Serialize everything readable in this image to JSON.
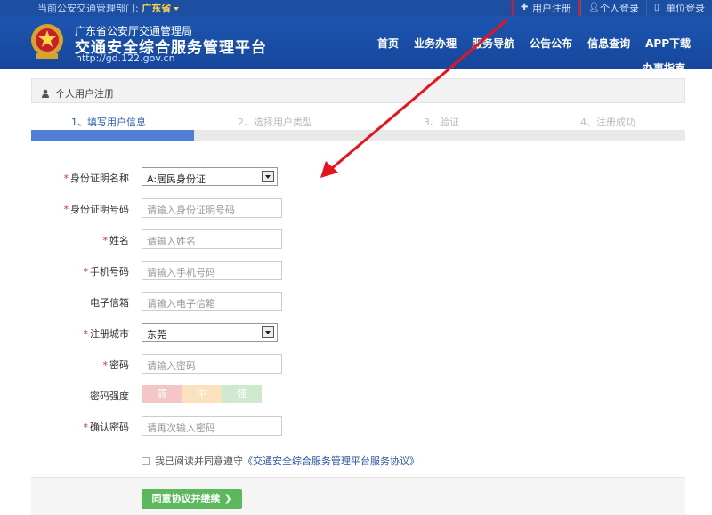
{
  "topbar": {
    "dept_prefix": "当前公安交通管理部门: ",
    "dept_name": "广东省",
    "links": {
      "register": "用户注册",
      "personal_login": "个人登录",
      "unit_login": "单位登录"
    }
  },
  "header": {
    "org": "广东省公安厅交通管理局",
    "title": "交通安全综合服务管理平台",
    "url": "http://gd.122.gov.cn",
    "nav": [
      "首页",
      "业务办理",
      "服务导航",
      "公告公布",
      "信息查询",
      "APP下载"
    ],
    "nav_sub": "办事指南"
  },
  "panel": {
    "title": "个人用户注册"
  },
  "steps": [
    "1、填写用户信息",
    "2、选择用户类型",
    "3、验证",
    "4、注册成功"
  ],
  "form": {
    "id_type": {
      "label": "身份证明名称",
      "value": "A:居民身份证"
    },
    "id_number": {
      "label": "身份证明号码",
      "placeholder": "请输入身份证明号码"
    },
    "name": {
      "label": "姓名",
      "placeholder": "请输入姓名"
    },
    "phone": {
      "label": "手机号码",
      "placeholder": "请输入手机号码"
    },
    "email": {
      "label": "电子信箱",
      "placeholder": "请输入电子信箱"
    },
    "city": {
      "label": "注册城市",
      "value": "东莞"
    },
    "password": {
      "label": "密码",
      "placeholder": "请输入密码"
    },
    "strength": {
      "label": "密码强度",
      "levels": [
        "弱",
        "中",
        "强"
      ]
    },
    "confirm": {
      "label": "确认密码",
      "placeholder": "请再次输入密码"
    }
  },
  "agree": {
    "text": "我已阅读并同意遵守",
    "link": "《交通安全综合服务管理平台服务协议》"
  },
  "submit": "同意协议并继续",
  "colors": {
    "header_blue": "#1d55b0",
    "annotation_red": "#e8141c",
    "button_green": "#5cb85c"
  }
}
